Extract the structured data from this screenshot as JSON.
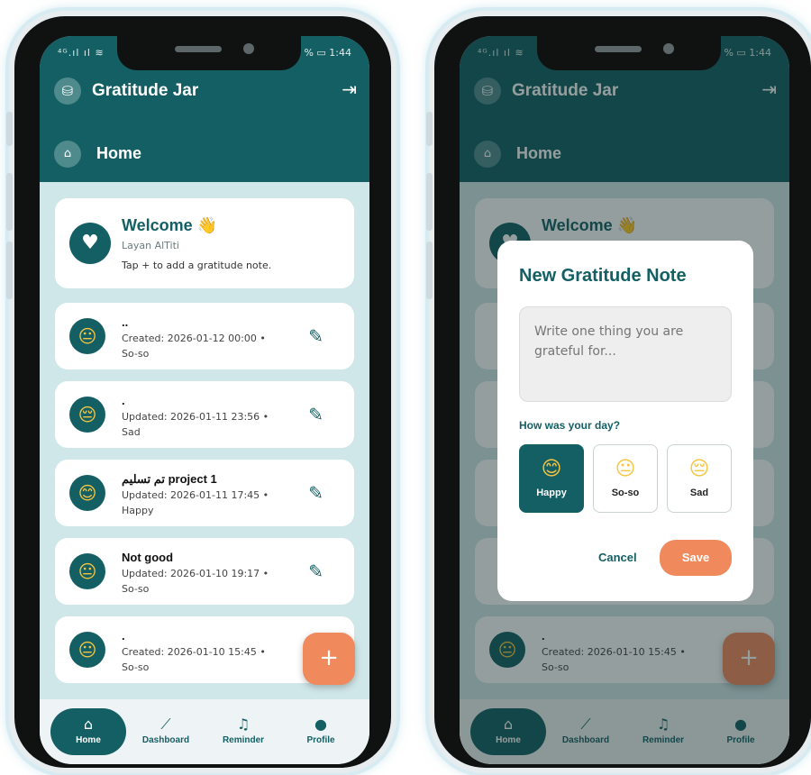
{
  "colors": {
    "primary": "#135f63",
    "accent": "#f08a5d",
    "background": "#d0e7e9"
  },
  "status": {
    "time": "1:44",
    "left": "⁴ᴳ.ıl ıl ≋",
    "battery": "% ▭"
  },
  "app": {
    "title": "Gratitude Jar",
    "section": "Home",
    "icon": "jar-icon",
    "logout_icon": "logout-icon"
  },
  "welcome": {
    "title": "Welcome 👋",
    "name": "Layan AlTiti",
    "hint": "Tap + to add a gratitude note."
  },
  "notes": [
    {
      "title": "..",
      "meta": "Created: 2026-01-12  00:00  •",
      "mood": "So-so",
      "face": "😐"
    },
    {
      "title": ".",
      "meta": "Updated: 2026-01-11  23:56  •",
      "mood": "Sad",
      "face": "😔"
    },
    {
      "title": "تم تسليم project 1",
      "meta": "Updated: 2026-01-11  17:45  •",
      "mood": "Happy",
      "face": "😊"
    },
    {
      "title": "Not good",
      "meta": "Updated: 2026-01-10  19:17  •",
      "mood": "So-so",
      "face": "😐"
    },
    {
      "title": ".",
      "meta": "Created: 2026-01-10  15:45  •",
      "mood": "So-so",
      "face": "😐"
    }
  ],
  "fab": {
    "label": "+"
  },
  "nav": [
    {
      "label": "Home",
      "icon": "home-icon",
      "glyph": "⌂"
    },
    {
      "label": "Dashboard",
      "icon": "chart-icon",
      "glyph": "⟋"
    },
    {
      "label": "Reminder",
      "icon": "bell-icon",
      "glyph": "♫"
    },
    {
      "label": "Profile",
      "icon": "person-icon",
      "glyph": "●"
    }
  ],
  "dialog": {
    "title": "New Gratitude Note",
    "placeholder": "Write one thing you are grateful for...",
    "question": "How was your day?",
    "moods": [
      {
        "label": "Happy",
        "face": "😊",
        "selected": true
      },
      {
        "label": "So-so",
        "face": "😐",
        "selected": false
      },
      {
        "label": "Sad",
        "face": "😔",
        "selected": false
      }
    ],
    "cancel": "Cancel",
    "save": "Save"
  }
}
